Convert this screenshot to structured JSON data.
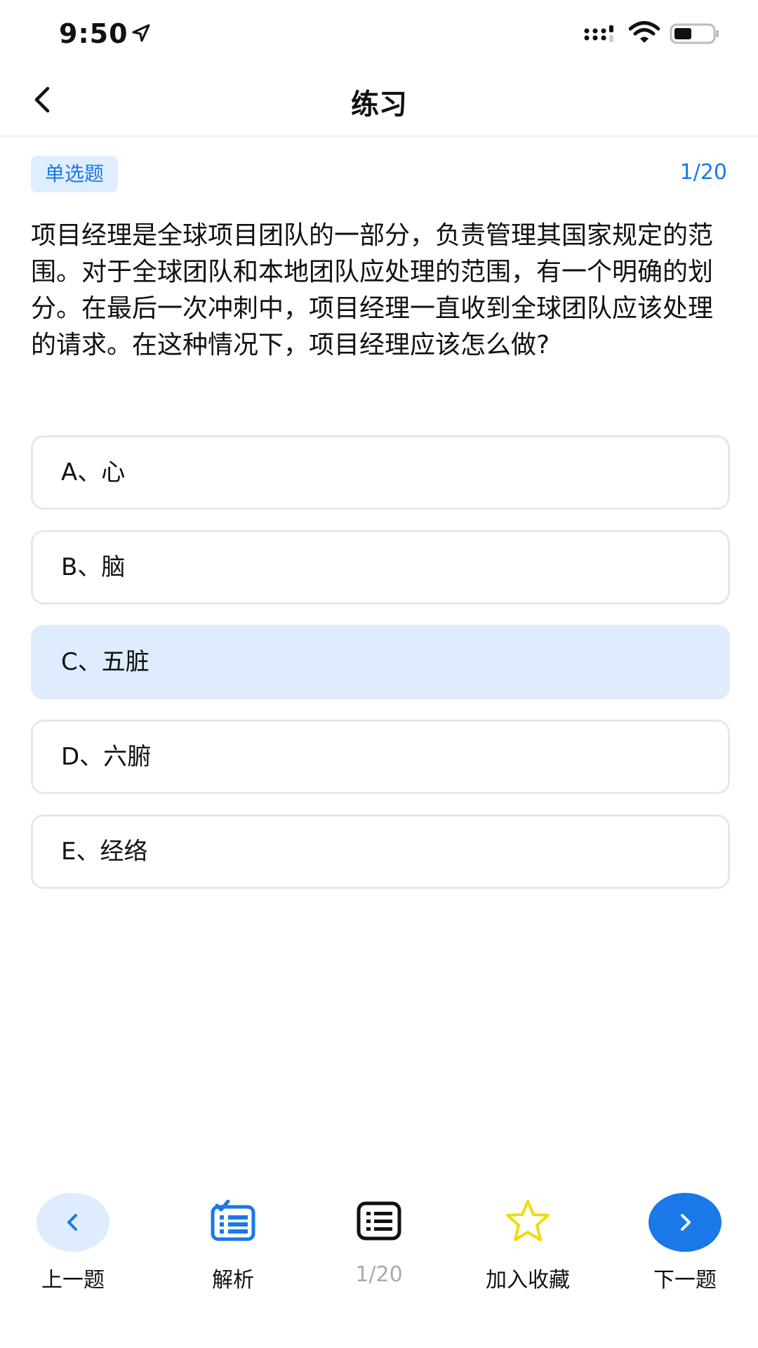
{
  "status_bar": {
    "time": "9:50",
    "icons": [
      "location-arrow-icon",
      "cellular-signal-icon",
      "wifi-icon",
      "battery-icon"
    ]
  },
  "nav": {
    "title": "练习",
    "back_icon": "chevron-left-icon"
  },
  "question": {
    "type_badge": "单选题",
    "progress": "1/20",
    "text": "项目经理是全球项目团队的一部分，负责管理其国家规定的范围。对于全球团队和本地团队应处理的范围，有一个明确的划分。在最后一次冲刺中，项目经理一直收到全球团队应该处理的请求。在这种情况下，项目经理应该怎么做?"
  },
  "options": [
    {
      "label": "A、心",
      "selected": false
    },
    {
      "label": "B、脑",
      "selected": false
    },
    {
      "label": "C、五脏",
      "selected": true
    },
    {
      "label": "D、六腑",
      "selected": false
    },
    {
      "label": "E、经络",
      "selected": false
    }
  ],
  "bottom_bar": {
    "prev": {
      "label": "上一题",
      "icon": "chevron-left-icon"
    },
    "analysis": {
      "label": "解析",
      "icon": "checklist-icon"
    },
    "progress": {
      "label": "1/20",
      "icon": "list-icon"
    },
    "favorite": {
      "label": "加入收藏",
      "icon": "star-icon"
    },
    "next": {
      "label": "下一题",
      "icon": "chevron-right-icon"
    }
  },
  "colors": {
    "accent": "#1a78e8",
    "accent_light": "#deecfd",
    "star": "#f5d90a",
    "border": "#e5e7eb"
  }
}
